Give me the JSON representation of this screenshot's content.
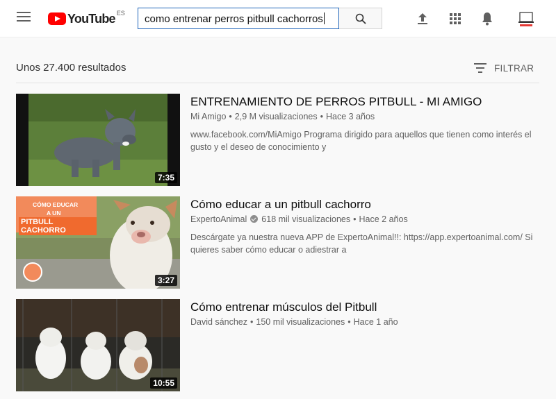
{
  "header": {
    "logo_text": "YouTube",
    "logo_country": "ES",
    "search_value": "como entrenar perros pitbull cachorros"
  },
  "results": {
    "count_text": "Unos 27.400 resultados",
    "filter_label": "FILTRAR"
  },
  "videos": [
    {
      "title": "ENTRENAMIENTO DE PERROS PITBULL - MI AMIGO",
      "channel": "Mi Amigo",
      "views": "2,9 M visualizaciones",
      "age": "Hace 3 años",
      "description": "www.facebook.com/MiAmigo Programa dirigido para aquellos que tienen como interés el gusto y el deseo de conocimiento y",
      "duration": "7:35"
    },
    {
      "title": "Cómo educar a un pitbull cachorro",
      "channel": "ExpertoAnimal",
      "verified": true,
      "views": "618 mil visualizaciones",
      "age": "Hace 2 años",
      "description": "Descárgate ya nuestra nueva APP de ExpertoAnimal!!: https://app.expertoanimal.com/ Si quieres saber cómo educar o adiestrar a",
      "duration": "3:27",
      "thumb_text": [
        "CÓMO EDUCAR",
        "A UN",
        "PITBULL CACHORRO"
      ]
    },
    {
      "title": "Cómo entrenar músculos del Pitbull",
      "channel": "David sánchez",
      "views": "150 mil visualizaciones",
      "age": "Hace 1 año",
      "description": "",
      "duration": "10:55"
    }
  ],
  "colors": {
    "brand_red": "#ff0000",
    "search_border": "#1c62b9",
    "meta_text": "#606060"
  },
  "icons": [
    "menu-icon",
    "youtube-logo-icon",
    "search-icon",
    "upload-icon",
    "apps-grid-icon",
    "notifications-bell-icon",
    "avatar-icon",
    "filter-icon",
    "verified-icon"
  ]
}
